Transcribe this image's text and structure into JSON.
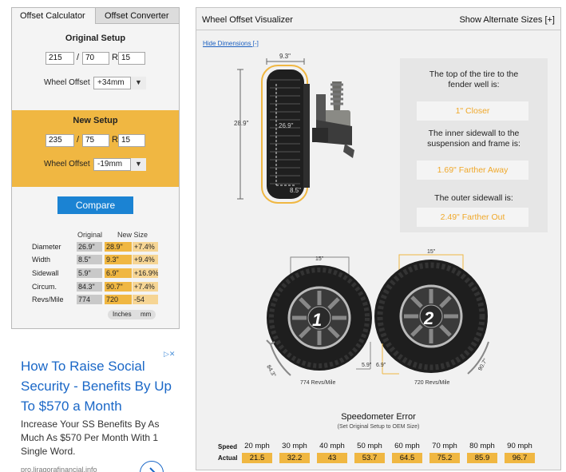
{
  "tabs": [
    {
      "label": "Offset Calculator",
      "active": true
    },
    {
      "label": "Offset Converter",
      "active": false
    }
  ],
  "original": {
    "title": "Original Setup",
    "width": "215",
    "aspect": "70",
    "rim_prefix": "R",
    "rim": "15",
    "offset_label": "Wheel Offset",
    "offset": "+34mm"
  },
  "new_setup": {
    "title": "New Setup",
    "width": "235",
    "aspect": "75",
    "rim_prefix": "R",
    "rim": "15",
    "offset_label": "Wheel Offset",
    "offset": "-19mm"
  },
  "separator": "/",
  "compare_label": "Compare",
  "comparison": {
    "col_original": "Original",
    "col_new": "New Size",
    "rows": [
      {
        "label": "Diameter",
        "orig": "26.9\"",
        "new": "28.9\"",
        "diff": "+7.4%"
      },
      {
        "label": "Width",
        "orig": "8.5\"",
        "new": "9.3\"",
        "diff": "+9.4%"
      },
      {
        "label": "Sidewall",
        "orig": "5.9\"",
        "new": "6.9\"",
        "diff": "+16.9%"
      },
      {
        "label": "Circum.",
        "orig": "84.3\"",
        "new": "90.7\"",
        "diff": "+7.4%"
      },
      {
        "label": "Revs/Mile",
        "orig": "774",
        "new": "720",
        "diff": "-54"
      }
    ],
    "units": [
      "Inches",
      "mm"
    ]
  },
  "ad": {
    "title": "How To Raise Social Security - Benefits By Up To $570 a Month",
    "text": "Increase Your SS Benefits By As Much As $570 Per Month With 1 Single Word.",
    "domain": "pro.liragorafinancial.info",
    "flag": "▷✕"
  },
  "visualizer": {
    "title": "Wheel Offset Visualizer",
    "alt_sizes": "Show Alternate Sizes [+]",
    "hide_dimensions": "Hide Dimensions [-]",
    "side_dims": {
      "width": "9.3\"",
      "height": "28.9\"",
      "inner_diameter": "26.9\"",
      "inner_width": "8.5\""
    },
    "results": [
      {
        "question": "The top of the tire to the fender well is:",
        "answer": "1\" Closer"
      },
      {
        "question": "The inner sidewall to the suspension and frame is:",
        "answer": "1.69\" Farther Away"
      },
      {
        "question": "The outer sidewall is:",
        "answer": "2.49\" Farther Out"
      }
    ],
    "wheel1": {
      "number": "1",
      "width": "15\"",
      "circ": "84.3\"",
      "sidewall": "5.9\"",
      "revs": "774 Revs/Mile"
    },
    "wheel2": {
      "number": "2",
      "width": "15\"",
      "circ": "90.7\"",
      "sidewall": "6.9\"",
      "revs": "720 Revs/Mile"
    }
  },
  "speedometer": {
    "title": "Speedometer Error",
    "subtitle": "(Set Original Setup to OEM Size)",
    "speed_label": "Speed",
    "actual_label": "Actual",
    "speeds": [
      "20 mph",
      "30 mph",
      "40 mph",
      "50 mph",
      "60 mph",
      "70 mph",
      "80 mph",
      "90 mph"
    ],
    "actual": [
      "21.5",
      "32.2",
      "43",
      "53.7",
      "64.5",
      "75.2",
      "85.9",
      "96.7"
    ]
  },
  "colors": {
    "accent_orange": "#f0b742",
    "button_blue": "#1b83d3",
    "link_blue": "#1a67c7"
  },
  "icons": {
    "offset_dropdown": "chevron-down-icon",
    "ad_go": "chevron-right-icon"
  }
}
